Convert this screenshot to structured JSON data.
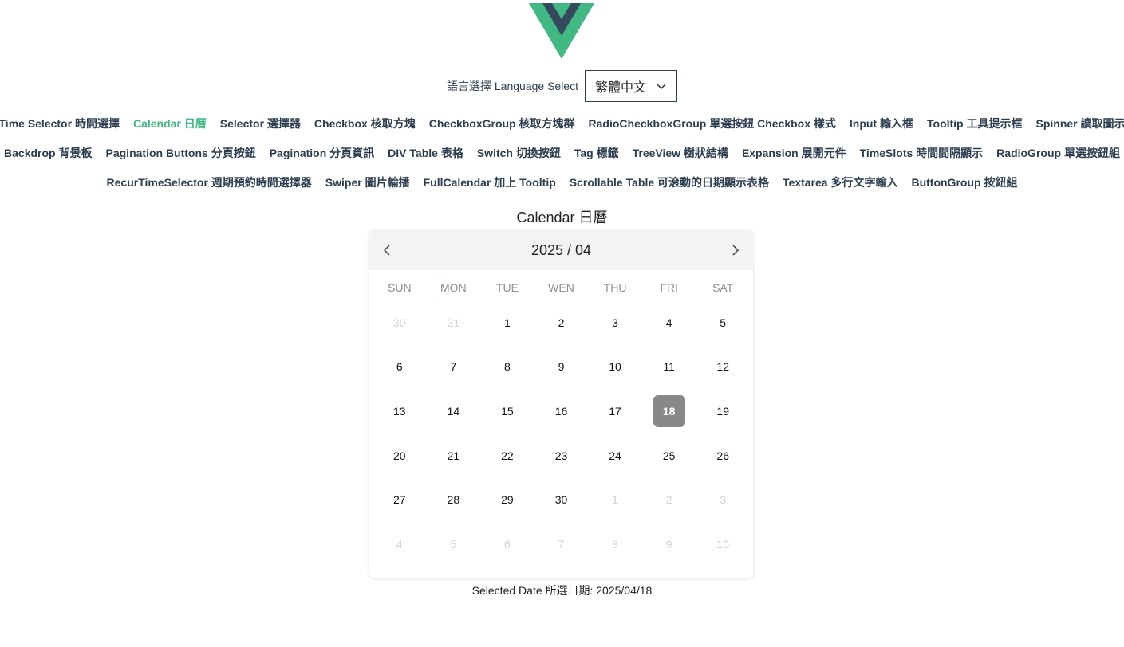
{
  "colors": {
    "accent": "#42b983",
    "text": "#2c3e50",
    "logo_dark": "#35495e",
    "selected_day_bg": "#888888",
    "muted_day": "#d3d3d3"
  },
  "language": {
    "label": "語言選擇 Language Select",
    "selected": "繁體中文",
    "icon": "chevron-down-icon"
  },
  "nav": {
    "row1": [
      {
        "label": "Time Selector 時間選擇",
        "active": false
      },
      {
        "label": "Calendar 日曆",
        "active": true
      },
      {
        "label": "Selector 選擇器",
        "active": false
      },
      {
        "label": "Checkbox 核取方塊",
        "active": false
      },
      {
        "label": "CheckboxGroup 核取方塊群",
        "active": false
      },
      {
        "label": "RadioCheckboxGroup 單選按鈕 Checkbox 樣式",
        "active": false
      },
      {
        "label": "Input 輸入框",
        "active": false
      },
      {
        "label": "Tooltip 工具提示框",
        "active": false
      },
      {
        "label": "Spinner 讀取圖示",
        "active": false
      }
    ],
    "row2": [
      {
        "label": "Backdrop 背景板",
        "active": false
      },
      {
        "label": "Pagination Buttons 分頁按鈕",
        "active": false
      },
      {
        "label": "Pagination 分頁資訊",
        "active": false
      },
      {
        "label": "DIV Table 表格",
        "active": false
      },
      {
        "label": "Switch 切換按鈕",
        "active": false
      },
      {
        "label": "Tag 標籤",
        "active": false
      },
      {
        "label": "TreeView 樹狀結構",
        "active": false
      },
      {
        "label": "Expansion 展開元件",
        "active": false
      },
      {
        "label": "TimeSlots 時間間隔顯示",
        "active": false
      },
      {
        "label": "RadioGroup 單選按鈕組",
        "active": false
      }
    ],
    "row3": [
      {
        "label": "RecurTimeSelector 週期預約時間選擇器",
        "active": false
      },
      {
        "label": "Swiper 圖片輪播",
        "active": false
      },
      {
        "label": "FullCalendar 加上 Tooltip",
        "active": false
      },
      {
        "label": "Scrollable Table 可滾動的日期顯示表格",
        "active": false
      },
      {
        "label": "Textarea 多行文字輸入",
        "active": false
      },
      {
        "label": "ButtonGroup 按鈕組",
        "active": false
      }
    ]
  },
  "calendar": {
    "title": "Calendar 日曆",
    "month_label": "2025 / 04",
    "prev_icon": "chevron-left-icon",
    "next_icon": "chevron-right-icon",
    "weekdays": [
      "SUN",
      "MON",
      "TUE",
      "WEN",
      "THU",
      "FRI",
      "SAT"
    ],
    "days": [
      {
        "d": "30",
        "other": true
      },
      {
        "d": "31",
        "other": true
      },
      {
        "d": "1"
      },
      {
        "d": "2"
      },
      {
        "d": "3"
      },
      {
        "d": "4"
      },
      {
        "d": "5"
      },
      {
        "d": "6"
      },
      {
        "d": "7"
      },
      {
        "d": "8"
      },
      {
        "d": "9"
      },
      {
        "d": "10"
      },
      {
        "d": "11"
      },
      {
        "d": "12"
      },
      {
        "d": "13"
      },
      {
        "d": "14"
      },
      {
        "d": "15"
      },
      {
        "d": "16"
      },
      {
        "d": "17"
      },
      {
        "d": "18",
        "selected": true
      },
      {
        "d": "19"
      },
      {
        "d": "20"
      },
      {
        "d": "21"
      },
      {
        "d": "22"
      },
      {
        "d": "23"
      },
      {
        "d": "24"
      },
      {
        "d": "25"
      },
      {
        "d": "26"
      },
      {
        "d": "27"
      },
      {
        "d": "28"
      },
      {
        "d": "29"
      },
      {
        "d": "30"
      },
      {
        "d": "1",
        "other": true
      },
      {
        "d": "2",
        "other": true
      },
      {
        "d": "3",
        "other": true
      },
      {
        "d": "4",
        "other": true
      },
      {
        "d": "5",
        "other": true
      },
      {
        "d": "6",
        "other": true
      },
      {
        "d": "7",
        "other": true
      },
      {
        "d": "8",
        "other": true
      },
      {
        "d": "9",
        "other": true
      },
      {
        "d": "10",
        "other": true
      }
    ]
  },
  "selected_date_text": "Selected Date 所選日期: 2025/04/18"
}
